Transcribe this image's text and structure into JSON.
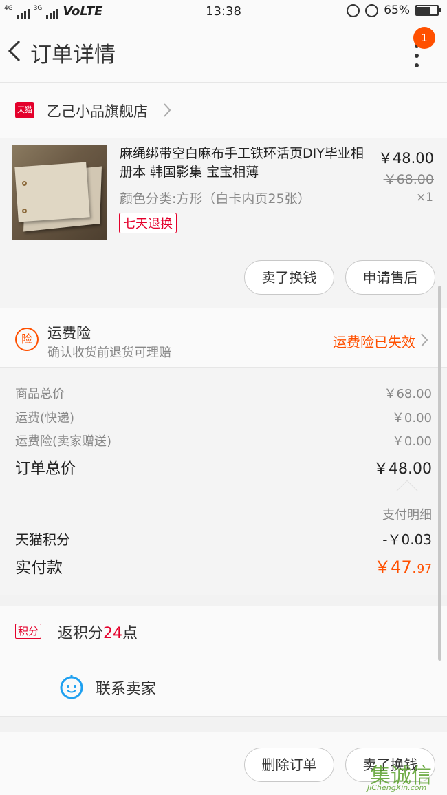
{
  "status_bar": {
    "network_left": "4G",
    "network_right": "3G",
    "carrier": "VoLTE",
    "time": "13:38",
    "battery_percent": "65%",
    "battery_level": 0.65
  },
  "nav": {
    "title": "订单详情",
    "badge_count": "1"
  },
  "shop": {
    "logo_text": "天猫",
    "name": "乙己小品旗舰店"
  },
  "product": {
    "name": "麻绳绑带空白麻布手工铁环活页DIY毕业相册本 韩国影集 宝宝相薄",
    "sku": "颜色分类:方形（白卡内页25张）",
    "tag": "七天退换",
    "price": "￥48.00",
    "original_price": "￥68.00",
    "quantity": "×1",
    "sell_button": "卖了换钱",
    "after_sale_button": "申请售后"
  },
  "insurance": {
    "icon_text": "险",
    "title": "运费险",
    "description": "确认收货前退货可理赔",
    "status": "运费险已失效"
  },
  "totals": {
    "items": [
      {
        "label": "商品总价",
        "value": "￥68.00"
      },
      {
        "label": "运费(快递)",
        "value": "￥0.00"
      },
      {
        "label": "运费险(卖家赠送)",
        "value": "￥0.00"
      }
    ],
    "order_total_label": "订单总价",
    "order_total_value": "￥48.00"
  },
  "payment": {
    "detail_link": "支付明细",
    "points_label": "天猫积分",
    "points_value": "-￥0.03",
    "paid_label": "实付款",
    "paid_integer": "￥47.",
    "paid_decimal": "97"
  },
  "points_return": {
    "icon_text": "积分",
    "prefix": "返积分",
    "number": "24",
    "suffix": "点"
  },
  "contact": {
    "label": "联系卖家"
  },
  "footer": {
    "delete_button": "删除订单",
    "sell_button": "卖了换钱"
  },
  "watermark": {
    "chinese": "集诚信",
    "english": "JiChengXin.com"
  },
  "colors": {
    "accent": "#ff5000",
    "tmall_red": "#e4002b",
    "contact_blue": "#1ea0f0"
  }
}
